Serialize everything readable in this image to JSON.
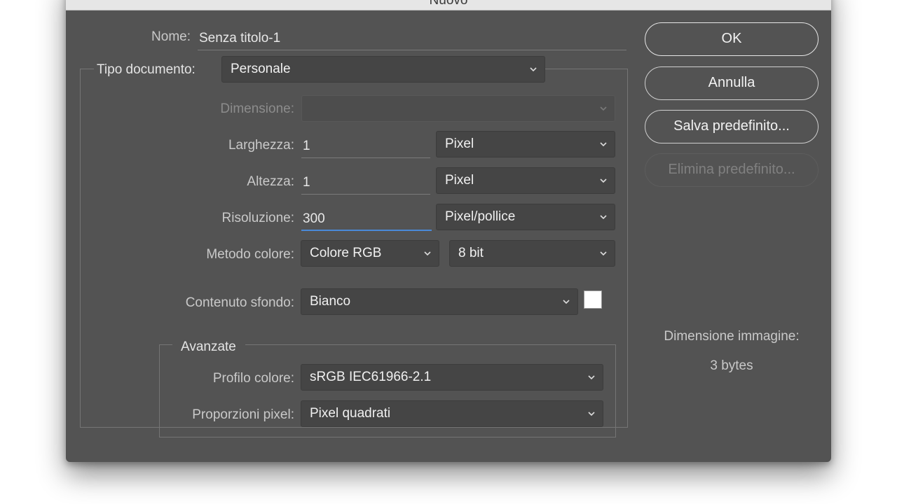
{
  "window": {
    "title": "Nuovo"
  },
  "name_field": {
    "label": "Nome:",
    "value": "Senza titolo-1"
  },
  "document_type": {
    "label": "Tipo documento:",
    "value": "Personale"
  },
  "size": {
    "label": "Dimensione:",
    "value": ""
  },
  "width": {
    "label": "Larghezza:",
    "value": "1",
    "unit": "Pixel"
  },
  "height": {
    "label": "Altezza:",
    "value": "1",
    "unit": "Pixel"
  },
  "resolution": {
    "label": "Risoluzione:",
    "value": "300",
    "unit": "Pixel/pollice"
  },
  "color_mode": {
    "label": "Metodo colore:",
    "mode": "Colore RGB",
    "depth": "8 bit"
  },
  "background": {
    "label": "Contenuto sfondo:",
    "value": "Bianco",
    "swatch_color": "#ffffff"
  },
  "advanced": {
    "title": "Avanzate",
    "profile": {
      "label": "Profilo colore:",
      "value": "sRGB IEC61966-2.1"
    },
    "aspect": {
      "label": "Proporzioni pixel:",
      "value": "Pixel quadrati"
    }
  },
  "buttons": {
    "ok": "OK",
    "cancel": "Annulla",
    "save_preset": "Salva predefinito...",
    "delete_preset": "Elimina predefinito..."
  },
  "image_size": {
    "label": "Dimensione immagine:",
    "value": "3 bytes"
  },
  "icons": {
    "dropdown": "chevron-down-icon"
  },
  "colors": {
    "dialog_bg": "#535353",
    "field_bg": "#454545",
    "active_underline": "#4a8ad8"
  }
}
